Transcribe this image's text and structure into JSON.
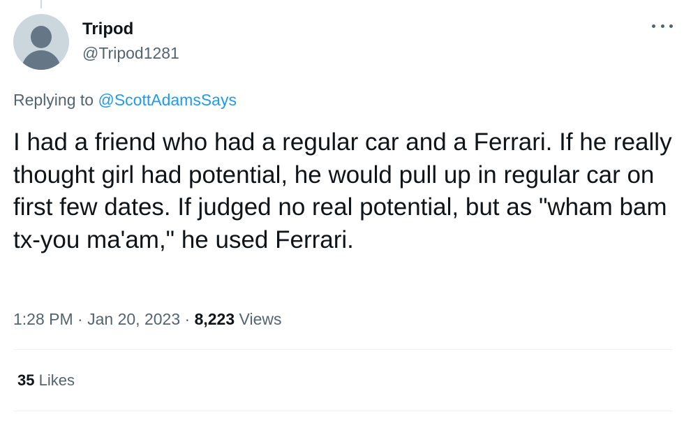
{
  "tweet": {
    "author": {
      "display_name": "Tripod",
      "handle": "@Tripod1281"
    },
    "more_icon": "more-dots-icon",
    "replying_to": {
      "prefix": "Replying to",
      "mention": "@ScottAdamsSays"
    },
    "text": "I had a friend who had a regular car and a Ferrari. If he really thought girl had potential, he would pull up in regular car on first few dates. If judged no real potential, but as \"wham bam tx-you ma'am,\" he used Ferrari.",
    "time": "1:28 PM",
    "separator": "·",
    "date": "Jan 20, 2023",
    "views_count": "8,223",
    "views_label": "Views",
    "likes_count": "35",
    "likes_label": "Likes"
  },
  "colors": {
    "link": "#1d9bf0",
    "secondary_text": "#536471",
    "primary_text": "#0f1419",
    "divider": "#eff3f4"
  }
}
